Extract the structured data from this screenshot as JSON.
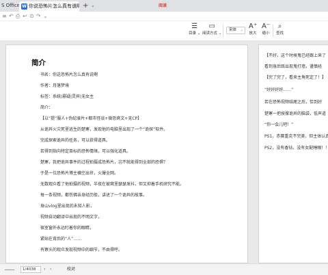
{
  "tabs": {
    "app_label": "S Office",
    "doc_icon": "W",
    "doc_label": "你说恐怖片怎么真有说啊.e",
    "close": "×",
    "add": "+",
    "more": "⌄",
    "center_badge": "阅读"
  },
  "quickbar": {
    "items": [
      "≡",
      "↶",
      "⎙",
      "↩",
      "⊙",
      "↷",
      "⌄"
    ]
  },
  "ribbon": {
    "catalog": {
      "icon": "☰",
      "label": "目录 ⌄"
    },
    "read_mode": {
      "icon": "▭",
      "label": "阅读方式 ⌄"
    },
    "font_select": "宋体",
    "font_select_arrow": "⌄",
    "zoom_in": {
      "icon": "A⁺",
      "label": "放大"
    },
    "zoom_out": {
      "icon": "A⁻",
      "label": "缩小"
    },
    "search": {
      "icon": "⌕",
      "label": "查找"
    }
  },
  "doc_left": {
    "heading": "简介",
    "paragraphs": [
      "书名：你这恐怖片怎么真有说啊",
      "作者：月落梦境",
      "标签：系统|悬疑|灵异|无女主",
      "简介：",
      "【以“提”服人+伪纪录片+都市怪谈+微恐爽文+无CP】",
      "从诡异火灾死里逃生的楚寒，发现他的电脑里出现了一个“诡探”软件。",
      "完成探索诡异的任务，可以获得道具。",
      "若得到指向特定目标的恐怖情绪，可以强化道具。",
      "楚寒，我把诡异事件的过程拍摄成恐怖片，岂不就能得到全部的恐惧？",
      "于是一位恐怖片博主横空出世，火爆全网。",
      "无数观众看了他拍摄的视频，半夜在被窝里瑟瑟发抖，但又抑着手机研究不能。",
      "每一条视频，都伤佛亲身经历般，讲述了一个诡异的故事。",
      "身山vlog里出现的未知人影，",
      "视频自动翻译中出现的不明文字，",
      "宿室窗外永远盯着你的眼睛，",
      "紧贴在背后的“人”……",
      "有察头的观众发现视频中的细节，不由得呼。"
    ]
  },
  "doc_right": {
    "paragraphs": [
      "【不好，这个时候鬼已经跟上来了",
      "看到身后既出现鬼打墙，谨慎经",
      "【完了完了，看来主角死定了！】",
      "“好好好好……”",
      "若在恐怖视频结尾之后，恰到好",
      "楚寒一把按撑诡异的脑袋，低声道",
      "“你一会儿吧！”",
      "PS1，赤赛重克不完美，但主体认真",
      "PS2，没有香钻，没有女配睡眼！！"
    ]
  },
  "status": {
    "page_field": "1/4038",
    "prev": "‹",
    "next": "›",
    "proofread": "校对"
  }
}
